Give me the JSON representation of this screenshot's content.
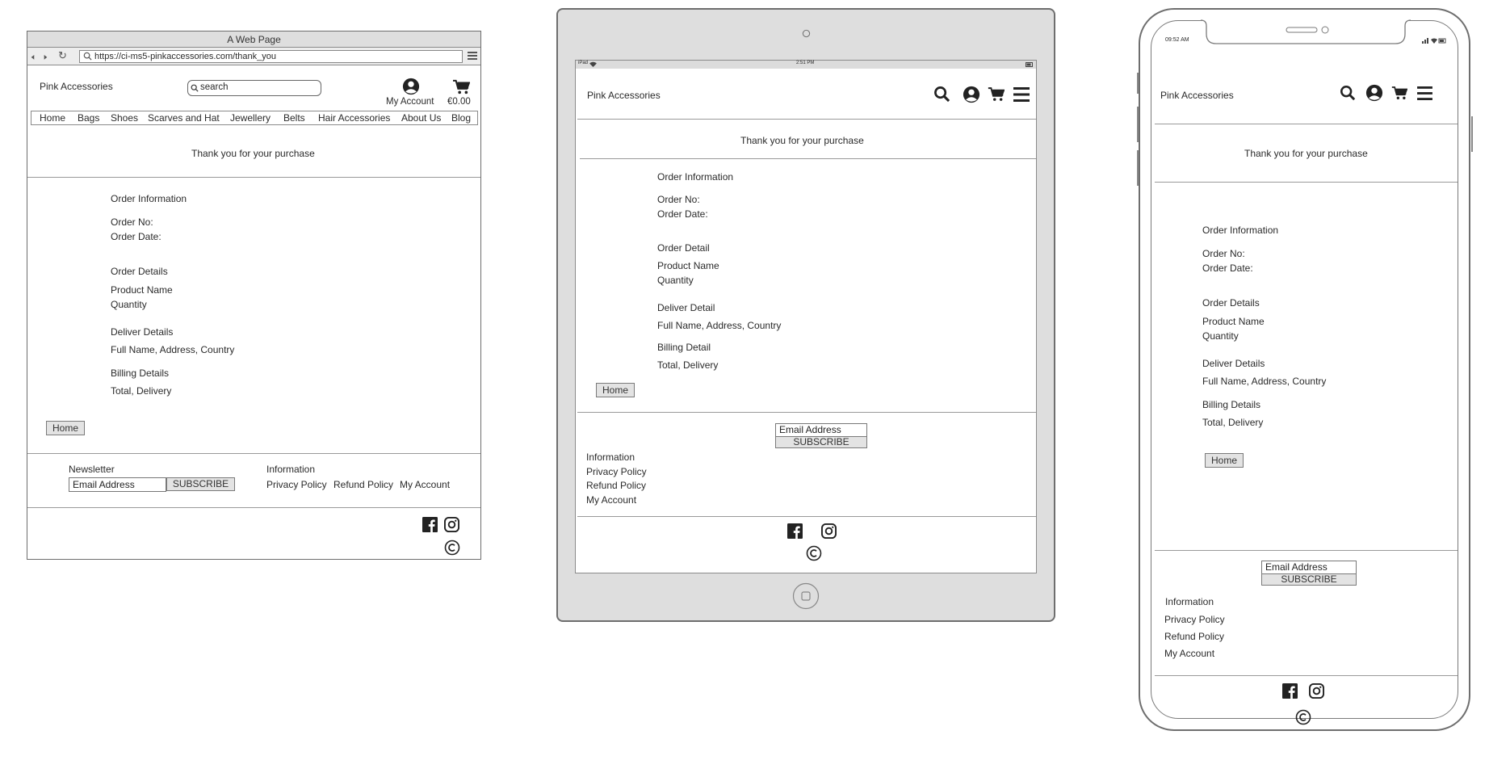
{
  "desktop": {
    "window_title": "A Web Page",
    "url": "https://ci-ms5-pinkaccessories.com/thank_you",
    "brand": "Pink Accessories",
    "search_placeholder": "search",
    "my_account": "My Account",
    "cart_total": "€0.00",
    "nav": [
      "Home",
      "Bags",
      "Shoes",
      "Scarves and Hat",
      "Jewellery",
      "Belts",
      "Hair Accessories",
      "About Us",
      "Blog"
    ],
    "thank_you": "Thank you for your purchase",
    "order_information": "Order Information",
    "order_no": "Order No:",
    "order_date": "Order Date:",
    "order_details": "Order Details",
    "product_name": "Product Name",
    "quantity": "Quantity",
    "deliver_details": "Deliver Details",
    "full_name": "Full Name, Address, Country",
    "billing_details": "Billing Details",
    "total_delivery": "Total, Delivery",
    "home_button": "Home",
    "newsletter": "Newsletter",
    "email_placeholder": "Email Address",
    "subscribe": "SUBSCRIBE",
    "information": "Information",
    "privacy_policy": "Privacy Policy",
    "refund_policy": "Refund Policy",
    "footer_my_account": "My Account"
  },
  "tablet": {
    "status_left": "iPad",
    "status_time": "2:51 PM",
    "brand": "Pink Accessories",
    "thank_you": "Thank you for your purchase",
    "order_information": "Order Information",
    "order_no": "Order No:",
    "order_date": "Order Date:",
    "order_detail": "Order Detail",
    "product_name": "Product Name",
    "quantity": "Quantity",
    "deliver_detail": "Deliver Detail",
    "full_name": "Full Name, Address, Country",
    "billing_detail": "Billing Detail",
    "total_delivery": "Total, Delivery",
    "home_button": "Home",
    "email_placeholder": "Email Address",
    "subscribe": "SUBSCRIBE",
    "information": "Information",
    "privacy_policy": "Privacy Policy",
    "refund_policy": "Refund Policy",
    "my_account": "My Account"
  },
  "phone": {
    "status_time": "09:52 AM",
    "brand": "Pink Accessories",
    "thank_you": "Thank you for your purchase",
    "order_information": "Order Information",
    "order_no": "Order No:",
    "order_date": "Order Date:",
    "order_details": "Order Details",
    "product_name": "Product Name",
    "quantity": "Quantity",
    "deliver_details": "Deliver Details",
    "full_name": "Full Name, Address, Country",
    "billing_details": "Billing Details",
    "total_delivery": "Total, Delivery",
    "home_button": "Home",
    "email_placeholder": "Email Address",
    "subscribe": "SUBSCRIBE",
    "information": "Information",
    "privacy_policy": "Privacy Policy",
    "refund_policy": "Refund Policy",
    "my_account": "My Account"
  },
  "icons": {
    "search": "search-icon",
    "account": "user-circle-icon",
    "cart": "cart-icon",
    "menu": "hamburger-icon",
    "facebook": "facebook-icon",
    "instagram": "instagram-icon",
    "copyright": "copyright-icon"
  },
  "colors": {
    "frame": "#6e6e6e",
    "device_bezel": "#dedede",
    "button_fill": "#e3e3e3"
  }
}
